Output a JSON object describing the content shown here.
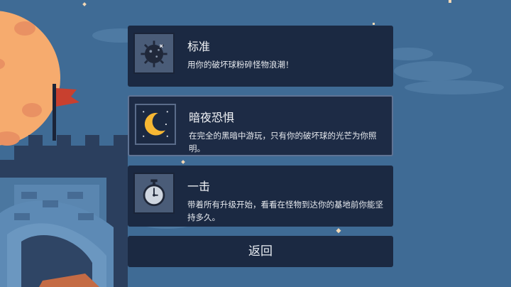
{
  "modes": [
    {
      "title": "标准",
      "description": "用你的破坏球粉碎怪物浪潮！",
      "icon": "wrecking-ball-icon"
    },
    {
      "title": "暗夜恐惧",
      "description": "在完全的黑暗中游玩，只有你的破坏球的光芒为你照明。",
      "icon": "crescent-moon-icon"
    },
    {
      "title": "一击",
      "description": "带着所有升级开始，看看在怪物到达你的基地前你能坚持多久。",
      "icon": "stopwatch-icon"
    }
  ],
  "back_label": "返回",
  "colors": {
    "background": "#3f6b95",
    "card": "#1b2942",
    "moon": "#f6b733",
    "flag": "#c8402f"
  }
}
